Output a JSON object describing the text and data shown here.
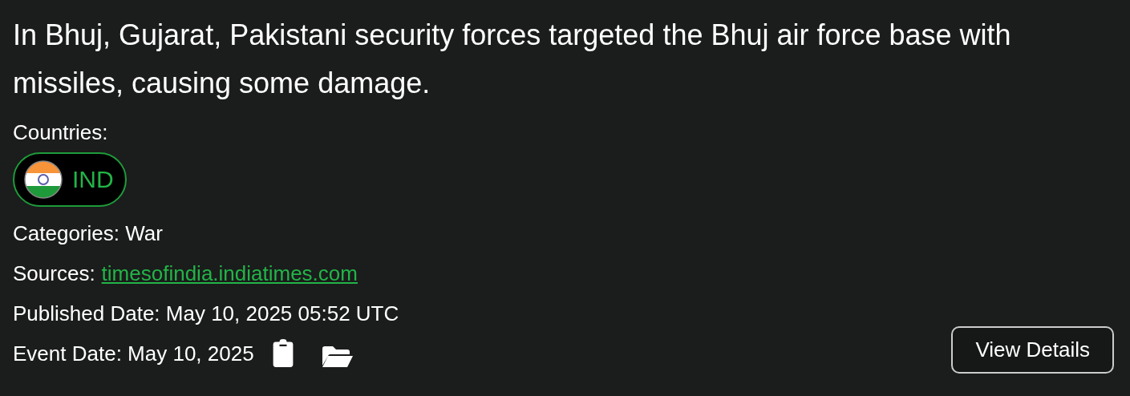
{
  "headline": "In Bhuj, Gujarat, Pakistani security forces targeted the Bhuj air force base with missiles, causing some damage.",
  "countries": {
    "label": "Countries:",
    "items": [
      {
        "code": "IND"
      }
    ]
  },
  "categories": {
    "label": "Categories:",
    "value": "War"
  },
  "sources": {
    "label": "Sources:",
    "links": [
      "timesofindia.indiatimes.com"
    ]
  },
  "published": {
    "label": "Published Date:",
    "value": "May 10, 2025 05:52 UTC"
  },
  "event": {
    "label": "Event Date:",
    "value": "May 10, 2025"
  },
  "button": "View Details"
}
